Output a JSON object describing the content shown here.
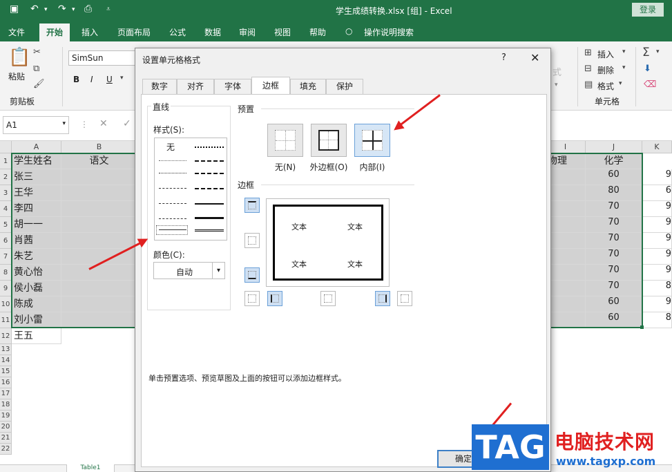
{
  "titlebar": {
    "doc_title": "学生成绩转换.xlsx  [组]  -  Excel",
    "login": "登录"
  },
  "ribbon_tabs": [
    "文件",
    "开始",
    "插入",
    "页面布局",
    "公式",
    "数据",
    "审阅",
    "视图",
    "帮助",
    "操作说明搜索"
  ],
  "ribbon": {
    "paste": "粘贴",
    "clipboard_group": "剪贴板",
    "font_name": "SimSun",
    "bold": "B",
    "italic": "I",
    "underline": "U",
    "insert": "插入",
    "delete": "删除",
    "format": "格式",
    "cells_group": "单元格"
  },
  "namebox": "A1",
  "columns": [
    "A",
    "B",
    "I",
    "J",
    "K"
  ],
  "headers": {
    "a": "学生姓名",
    "b": "语文",
    "i": "物理",
    "j": "化学"
  },
  "rows": [
    {
      "num": "1"
    },
    {
      "num": "2",
      "name": "张三",
      "chem": "60",
      "k": "9"
    },
    {
      "num": "3",
      "name": "王华",
      "chem": "80",
      "k": "6"
    },
    {
      "num": "4",
      "name": "李四",
      "chem": "70",
      "k": "9"
    },
    {
      "num": "5",
      "name": "胡一一",
      "chem": "70",
      "k": "9"
    },
    {
      "num": "6",
      "name": "肖茜",
      "chem": "70",
      "k": "9"
    },
    {
      "num": "7",
      "name": "朱艺",
      "chem": "70",
      "k": "9"
    },
    {
      "num": "8",
      "name": "黄心怡",
      "chem": "70",
      "k": "9"
    },
    {
      "num": "9",
      "name": "侯小磊",
      "chem": "70",
      "k": "8"
    },
    {
      "num": "10",
      "name": "陈成",
      "chem": "60",
      "k": "9"
    },
    {
      "num": "11",
      "name": "刘小雷",
      "chem": "60",
      "k": "8"
    },
    {
      "num": "12",
      "name": "王五"
    }
  ],
  "extra_rows": [
    "13",
    "14",
    "15",
    "16",
    "17",
    "18",
    "19",
    "20",
    "21",
    "22"
  ],
  "sheet_tab": "Table1",
  "dialog": {
    "title": "设置单元格格式",
    "help": "?",
    "close": "✕",
    "tabs": [
      "数字",
      "对齐",
      "字体",
      "边框",
      "填充",
      "保护"
    ],
    "line_group": "直线",
    "style_label": "样式(S):",
    "style_none": "无",
    "color_label": "颜色(C):",
    "color_value": "自动",
    "presets_group": "预置",
    "presets": [
      "无(N)",
      "外边框(O)",
      "内部(I)"
    ],
    "border_group": "边框",
    "preview_text": "文本",
    "hint": "单击预置选项、预览草图及上面的按钮可以添加边框样式。",
    "ok": "确定"
  },
  "watermark": {
    "logo": "TAG",
    "name": "电脑技术网",
    "url": "www.tagxp.com"
  }
}
